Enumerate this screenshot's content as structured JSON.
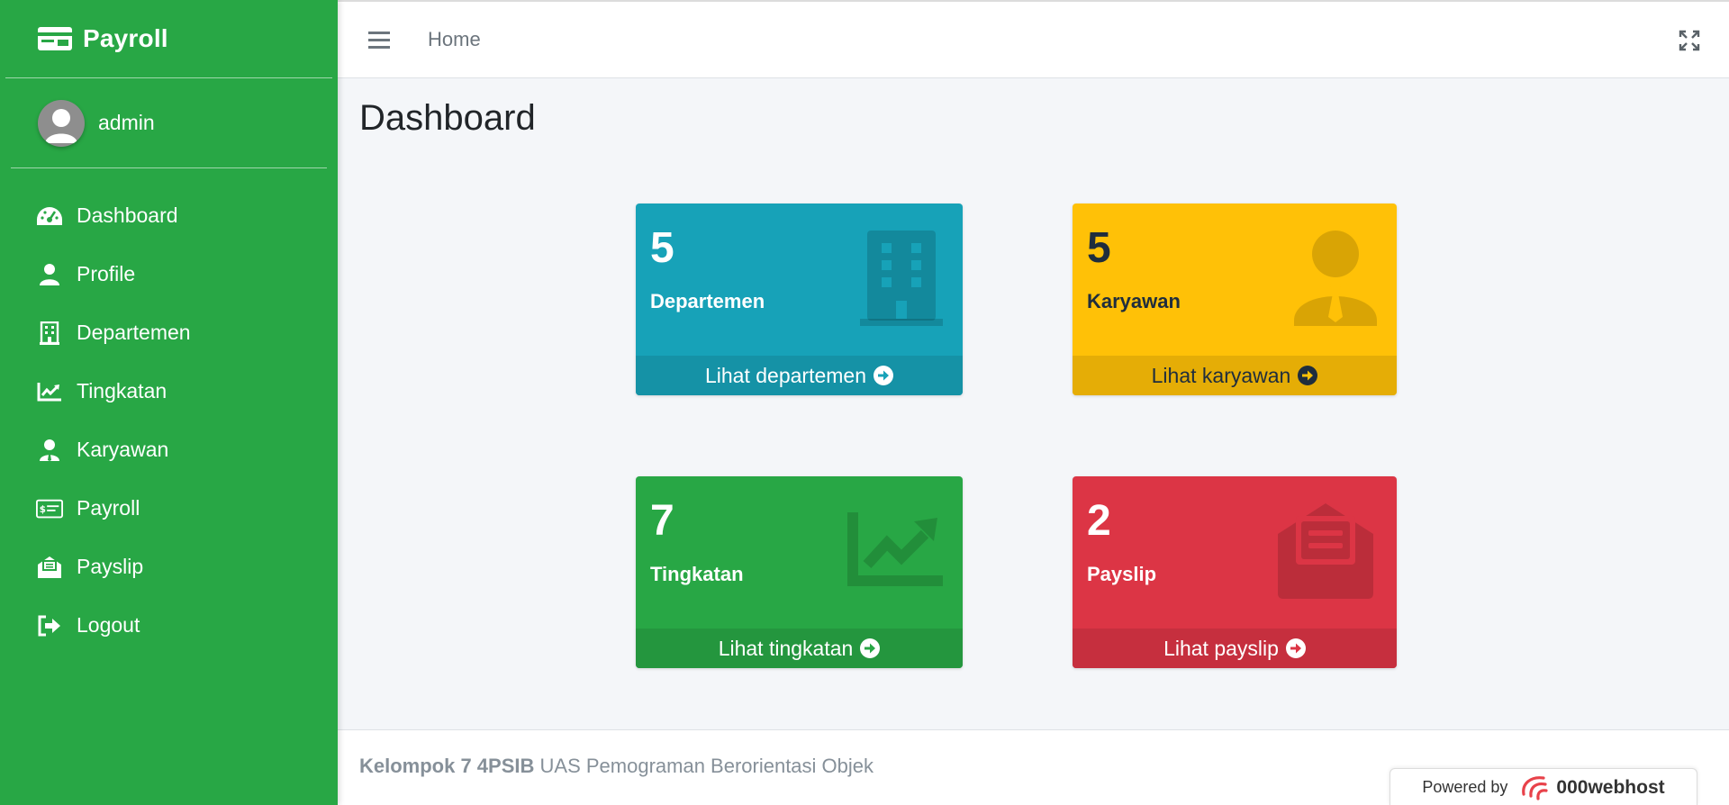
{
  "sidebar": {
    "brand": "Payroll",
    "user": "admin",
    "items": [
      {
        "label": "Dashboard",
        "icon": "tachometer-icon"
      },
      {
        "label": "Profile",
        "icon": "user-icon"
      },
      {
        "label": "Departemen",
        "icon": "building-icon"
      },
      {
        "label": "Tingkatan",
        "icon": "chart-line-icon"
      },
      {
        "label": "Karyawan",
        "icon": "user-tie-icon"
      },
      {
        "label": "Payroll",
        "icon": "money-check-icon"
      },
      {
        "label": "Payslip",
        "icon": "envelope-open-text-icon"
      },
      {
        "label": "Logout",
        "icon": "sign-out-icon"
      }
    ]
  },
  "topbar": {
    "home": "Home"
  },
  "main": {
    "title": "Dashboard",
    "cards": [
      {
        "count": "5",
        "label": "Departemen",
        "link": "Lihat departemen",
        "color": "#17a2b8"
      },
      {
        "count": "5",
        "label": "Karyawan",
        "link": "Lihat karyawan",
        "color": "#ffc107"
      },
      {
        "count": "7",
        "label": "Tingkatan",
        "link": "Lihat tingkatan",
        "color": "#28a745"
      },
      {
        "count": "2",
        "label": "Payslip",
        "link": "Lihat payslip",
        "color": "#dc3545"
      }
    ]
  },
  "footer": {
    "team": "Kelompok 7 4PSIB",
    "course": "UAS Pemograman Berorientasi Objek",
    "powered_by": "Powered by",
    "host": "000webhost"
  }
}
